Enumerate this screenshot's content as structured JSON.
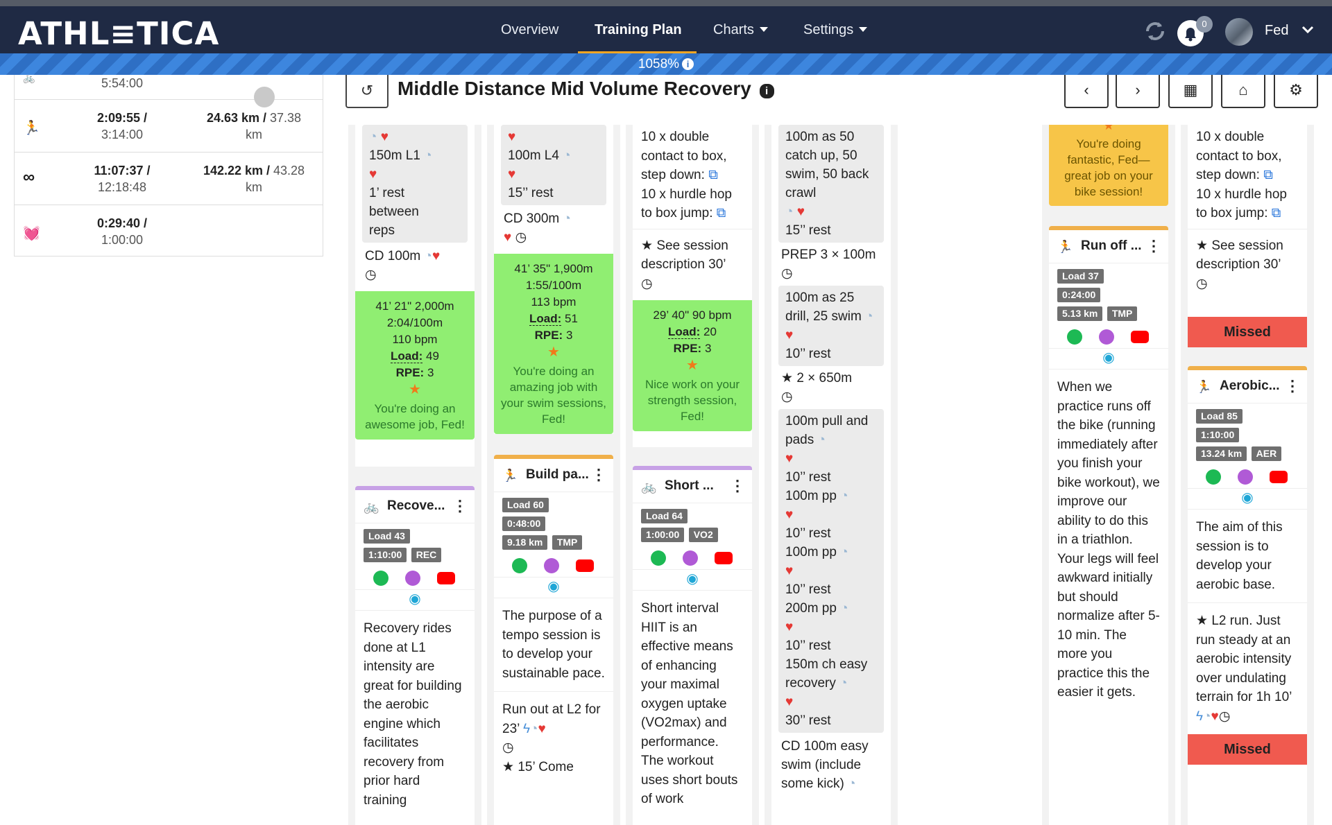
{
  "app": {
    "logo": "ATHL≡TICA"
  },
  "nav": {
    "overview": "Overview",
    "training_plan": "Training Plan",
    "charts": "Charts",
    "settings": "Settings",
    "notifications_count": "0",
    "user": "Fed"
  },
  "progress": {
    "label": "1058%",
    "value_percent": 1058
  },
  "sidebar": {
    "rows": [
      {
        "icon": "bike-icon",
        "left": "5:54:00",
        "right": ""
      },
      {
        "icon": "run-icon",
        "left_main": "2:09:55 /",
        "left_sub": "3:14:00",
        "right_main": "24.63 km /",
        "right_rest": " 37.38",
        "right_sub": "km"
      },
      {
        "icon": "infinity-icon",
        "left_main": "11:07:37 /",
        "left_sub": "12:18:48",
        "right_main": "142.22 km /",
        "right_rest": " 43.28",
        "right_sub": "km"
      },
      {
        "icon": "heartbeat-icon",
        "left_main": "0:29:40 /",
        "left_sub": "1:00:00"
      }
    ]
  },
  "page": {
    "title": "Middle Distance Mid Volume Recovery"
  },
  "col1": {
    "b1": "150m L1",
    "b2a": "1’ rest",
    "b2b": "between",
    "b2c": "reps",
    "cd": "CD 100m",
    "g1": "41’ 21\"   2,000m",
    "g2": "2:04/100m",
    "g3": "110 bpm",
    "load_label": "Load:",
    "load": " 49",
    "rpe_label": "RPE:",
    "rpe": " 3",
    "msg": "You're doing an awesome job, Fed!",
    "w_title": "Recove...",
    "tags": [
      "Load 43",
      "1:10:00",
      "REC"
    ],
    "desc": "Recovery rides done at L1 intensity are great for building the aerobic engine which facilitates recovery from prior hard training"
  },
  "col2": {
    "b1": "100m L4",
    "b2": "15’’ rest",
    "cd": "CD 300m",
    "g1": "41’ 35\"   1,900m",
    "g2": "1:55/100m",
    "g3": "113 bpm",
    "load_label": "Load:",
    "load": " 51",
    "rpe_label": "RPE:",
    "rpe": " 3",
    "msg": "You're doing an amazing job with your swim sessions, Fed!",
    "w_title": "Build pa...",
    "tags": [
      "Load 60",
      "0:48:00",
      "9.18 km",
      "TMP"
    ],
    "desc": "The purpose of a tempo session is to develop your sustainable pace.",
    "run1": "Run out at L2 for 23’",
    "run2": "15’ Come"
  },
  "col3": {
    "l1": "10 x double contact to box, step down:",
    "l2": "10 x hurdle hop to box jump:",
    "see": "See session description 30’",
    "g1": "29’ 40\"   90 bpm",
    "load_label": "Load:",
    "load": " 20",
    "rpe_label": "RPE:",
    "rpe": " 3",
    "msg": "Nice work on your strength session, Fed!",
    "w_title": "Short ...",
    "tags": [
      "Load 64",
      "1:00:00",
      "VO2"
    ],
    "desc": "Short interval HIIT is an effective means of enhancing your maximal oxygen uptake (VO2max) and performance. The workout uses short bouts of work"
  },
  "col4": {
    "a1": "100m as 50 catch up, 50 swim, 50 back crawl",
    "a2": "15’’ rest",
    "prep": "PREP 3 × 100m",
    "b1": "100m as 25 drill, 25 swim",
    "b2": "10’’ rest",
    "main": "2 × 650m",
    "c1": "100m pull and pads",
    "c2": "10’’ rest",
    "c3": "100m pp",
    "c4": "10’’ rest",
    "c5": "100m pp",
    "c6": "10’’ rest",
    "c7": "200m pp",
    "c8": "10’’ rest",
    "c9": "150m ch easy recovery",
    "c10": "30’’ rest",
    "cd": "CD 100m easy swim (include some kick)"
  },
  "col6": {
    "msg": "You're doing fantastic, Fed—great job on your bike session!",
    "w_title": "Run off ...",
    "tags": [
      "Load 37",
      "0:24:00",
      "5.13 km",
      "TMP"
    ],
    "desc": "When we practice runs off the bike (running immediately after you finish your bike workout), we improve our ability to do this in a triathlon. Your legs will feel awkward initially but should normalize after 5-10 min. The more you practice this the easier it gets."
  },
  "col7": {
    "l1": "10 x double contact to box, step down:",
    "l2": "10 x hurdle hop to box jump:",
    "see": "See session description 30’",
    "missed": "Missed",
    "w_title": "Aerobic...",
    "tags": [
      "Load 85",
      "1:10:00",
      "13.24 km",
      "AER"
    ],
    "desc": "The aim of this session is to develop your aerobic base.",
    "run": "L2 run. Just run steady at an aerobic intensity over undulating terrain for 1h 10’",
    "missed2": "Missed"
  },
  "colors": {
    "nav_bg": "#1f2a44",
    "accent": "#f5a623",
    "green": "#90ee72",
    "missed": "#f05a4f",
    "yellow": "#f7c548"
  }
}
